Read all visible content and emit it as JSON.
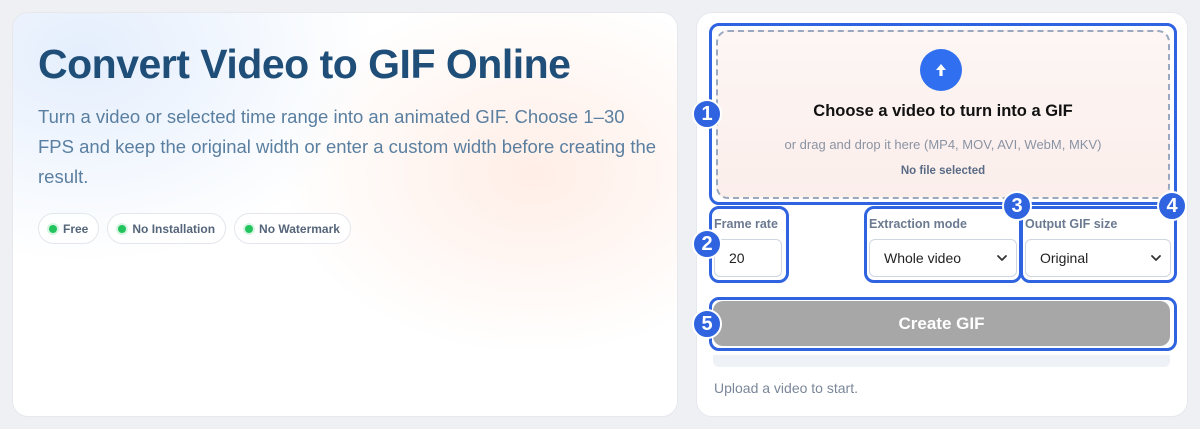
{
  "hero": {
    "title": "Convert Video to GIF Online",
    "description": "Turn a video or selected time range into an animated GIF. Choose 1–30 FPS and keep the original width or enter a custom width before creating the result.",
    "badges": [
      "Free",
      "No Installation",
      "No Watermark"
    ]
  },
  "upload": {
    "icon": "arrow-up-icon",
    "title": "Choose a video to turn into a GIF",
    "subtitle": "or drag and drop it here (MP4, MOV, AVI, WebM, MKV)",
    "status": "No file selected"
  },
  "settings": {
    "frame_rate_label": "Frame rate",
    "frame_rate_value": "20",
    "extraction_label": "Extraction mode",
    "extraction_value": "Whole video",
    "size_label": "Output GIF size",
    "size_value": "Original"
  },
  "actions": {
    "create_label": "Create GIF",
    "progress_fraction": 0,
    "status_text": "Upload a video to start."
  },
  "annotations": [
    "1",
    "2",
    "3",
    "4",
    "5"
  ],
  "colors": {
    "title": "#1f4e79",
    "accent": "#2f63e0",
    "button_disabled": "#a7a7a7",
    "badge_dot": "#23c45e"
  }
}
